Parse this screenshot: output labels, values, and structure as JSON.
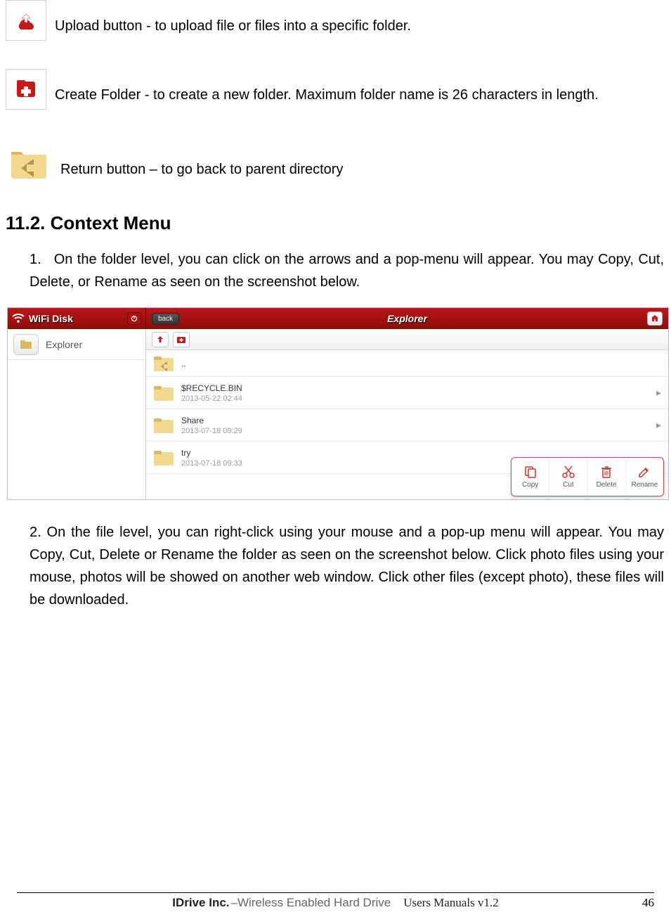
{
  "icons": {
    "upload_desc": "Upload button - to upload file or files into a specific folder.",
    "create_desc": "Create Folder - to create a new folder.   Maximum folder name is 26 characters in length.",
    "return_desc": "Return button – to go back to parent directory"
  },
  "section_heading": "11.2. Context Menu",
  "paragraphs": {
    "p1_num": "1.",
    "p1": "On the folder level, you can click on the arrows and a pop-menu will appear.   You may Copy, Cut, Delete, or Rename as seen on the screenshot below.",
    "p2": "2. On the file level, you can right-click using your mouse and a pop-up menu will appear.   You may Copy, Cut, Delete or Rename the folder as seen on the screenshot below.   Click photo files using your mouse, photos will be showed on another web window.   Click other files (except photo), these files will be downloaded."
  },
  "screenshot": {
    "sidebar_title": "WiFi Disk",
    "sidebar_item": "Explorer",
    "back_label": "back",
    "main_title": "Explorer",
    "updir_label": "..",
    "rows": [
      {
        "name": "$RECYCLE.BIN",
        "date": "2013-05-22 02:44"
      },
      {
        "name": "Share",
        "date": "2013-07-18 09:29"
      },
      {
        "name": "try",
        "date": "2013-07-18 09:33"
      }
    ],
    "context": {
      "copy": "Copy",
      "cut": "Cut",
      "delete": "Delete",
      "rename": "Rename"
    }
  },
  "footer": {
    "brand": "IDrive Inc.",
    "sub": "–Wireless Enabled Hard Drive",
    "subtitle": "Users Manuals v1.2",
    "page": "46"
  }
}
